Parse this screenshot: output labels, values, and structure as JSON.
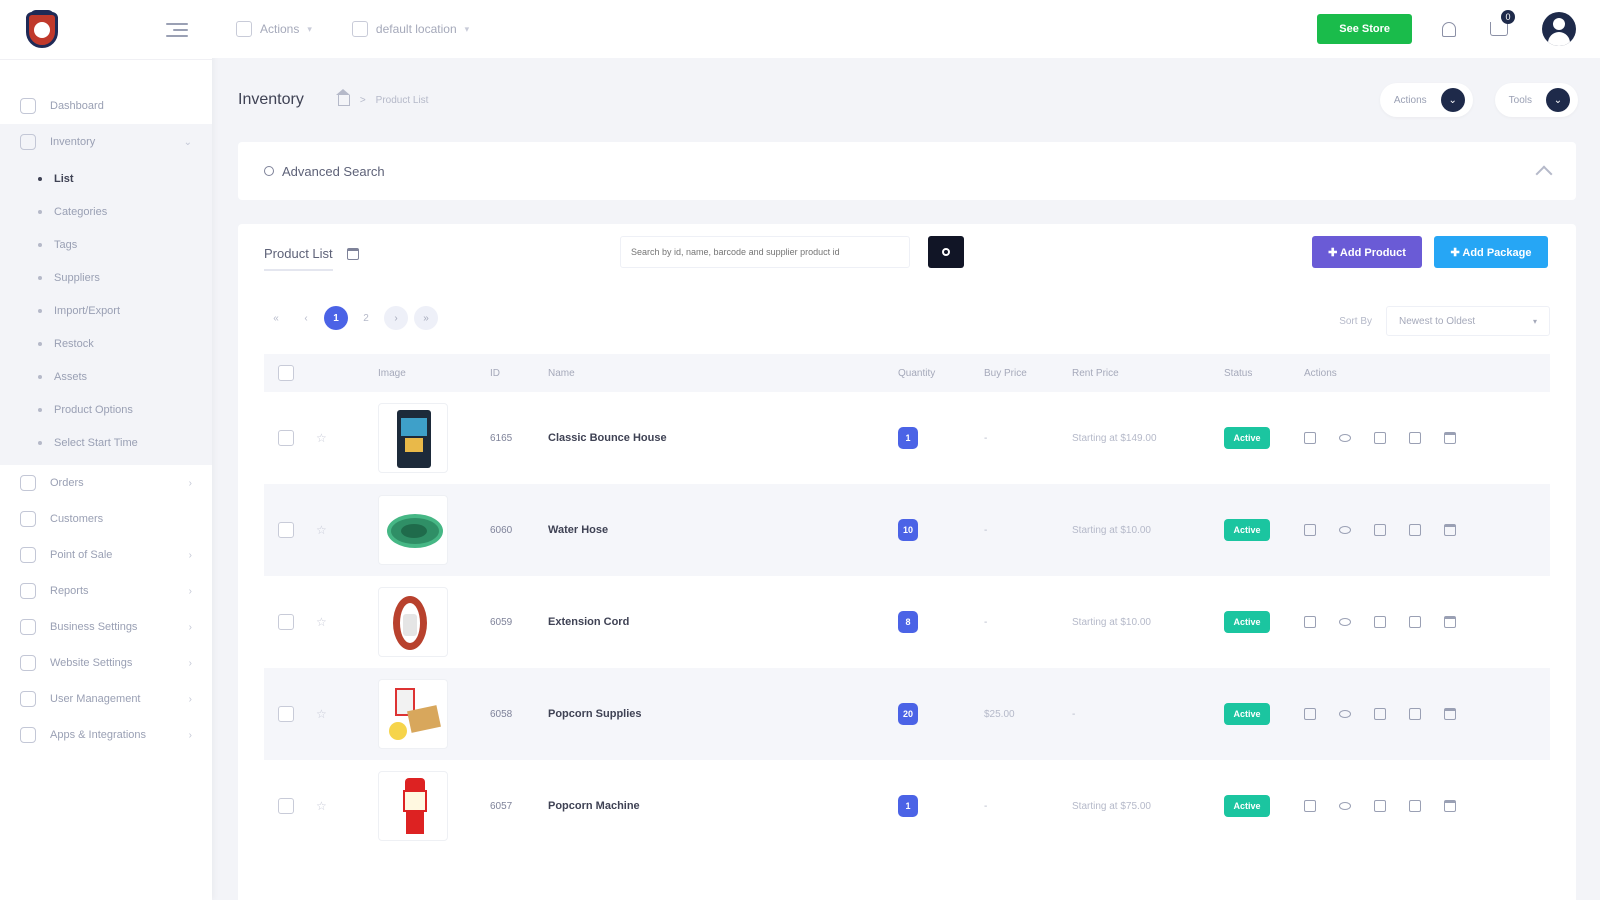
{
  "sidebar": {
    "nav": [
      {
        "label": "Dashboard",
        "icon": "dashboard-icon"
      },
      {
        "label": "Inventory",
        "icon": "box-icon"
      }
    ],
    "inventory_sub": [
      "List",
      "Categories",
      "Tags",
      "Suppliers",
      "Import/Export",
      "Restock",
      "Assets",
      "Product Options",
      "Select Start Time"
    ],
    "nav_after": [
      {
        "label": "Orders",
        "icon": "orders-icon"
      },
      {
        "label": "Customers",
        "icon": "customers-icon"
      },
      {
        "label": "Point of Sale",
        "icon": "pos-icon"
      },
      {
        "label": "Reports",
        "icon": "reports-icon"
      },
      {
        "label": "Business Settings",
        "icon": "gear-icon"
      },
      {
        "label": "Website Settings",
        "icon": "monitor-icon"
      },
      {
        "label": "User Management",
        "icon": "user-icon"
      },
      {
        "label": "Apps & Integrations",
        "icon": "apps-grid-icon"
      }
    ]
  },
  "topbar": {
    "actions_label": "Actions",
    "location_label": "default location",
    "see_store_label": "See Store",
    "cart_count": "0"
  },
  "header": {
    "title": "Inventory",
    "breadcrumb_current": "Product List",
    "actions_btn": "Actions",
    "tools_btn": "Tools"
  },
  "advanced_search": {
    "label": "Advanced Search"
  },
  "product_list": {
    "title": "Product List",
    "search_placeholder": "Search by id, name, barcode and supplier product id",
    "add_product_label": "✚ Add Product",
    "add_package_label": "✚ Add Package",
    "pagination": [
      "«",
      "‹",
      "1",
      "2",
      "›",
      "»"
    ],
    "sort_label": "Sort By",
    "sort_value": "Newest to Oldest",
    "columns": [
      "Image",
      "ID",
      "Name",
      "Quantity",
      "Buy Price",
      "Rent Price",
      "Status",
      "Actions"
    ],
    "rows": [
      {
        "id": "6165",
        "name": "Classic Bounce House",
        "quantity": "1",
        "buy_price": "-",
        "rent_price": "Starting at $149.00",
        "status": "Active"
      },
      {
        "id": "6060",
        "name": "Water Hose",
        "quantity": "10",
        "buy_price": "-",
        "rent_price": "Starting at $10.00",
        "status": "Active"
      },
      {
        "id": "6059",
        "name": "Extension Cord",
        "quantity": "8",
        "buy_price": "-",
        "rent_price": "Starting at $10.00",
        "status": "Active"
      },
      {
        "id": "6058",
        "name": "Popcorn Supplies",
        "quantity": "20",
        "buy_price": "$25.00",
        "rent_price": "-",
        "status": "Active"
      },
      {
        "id": "6057",
        "name": "Popcorn Machine",
        "quantity": "1",
        "buy_price": "-",
        "rent_price": "Starting at $75.00",
        "status": "Active"
      }
    ]
  },
  "colors": {
    "see_store": "#1abc4b",
    "add_product": "#6a5bd6",
    "add_package": "#26a6f5",
    "status_active": "#1bc5a0",
    "quantity_badge": "#4b63e6"
  }
}
